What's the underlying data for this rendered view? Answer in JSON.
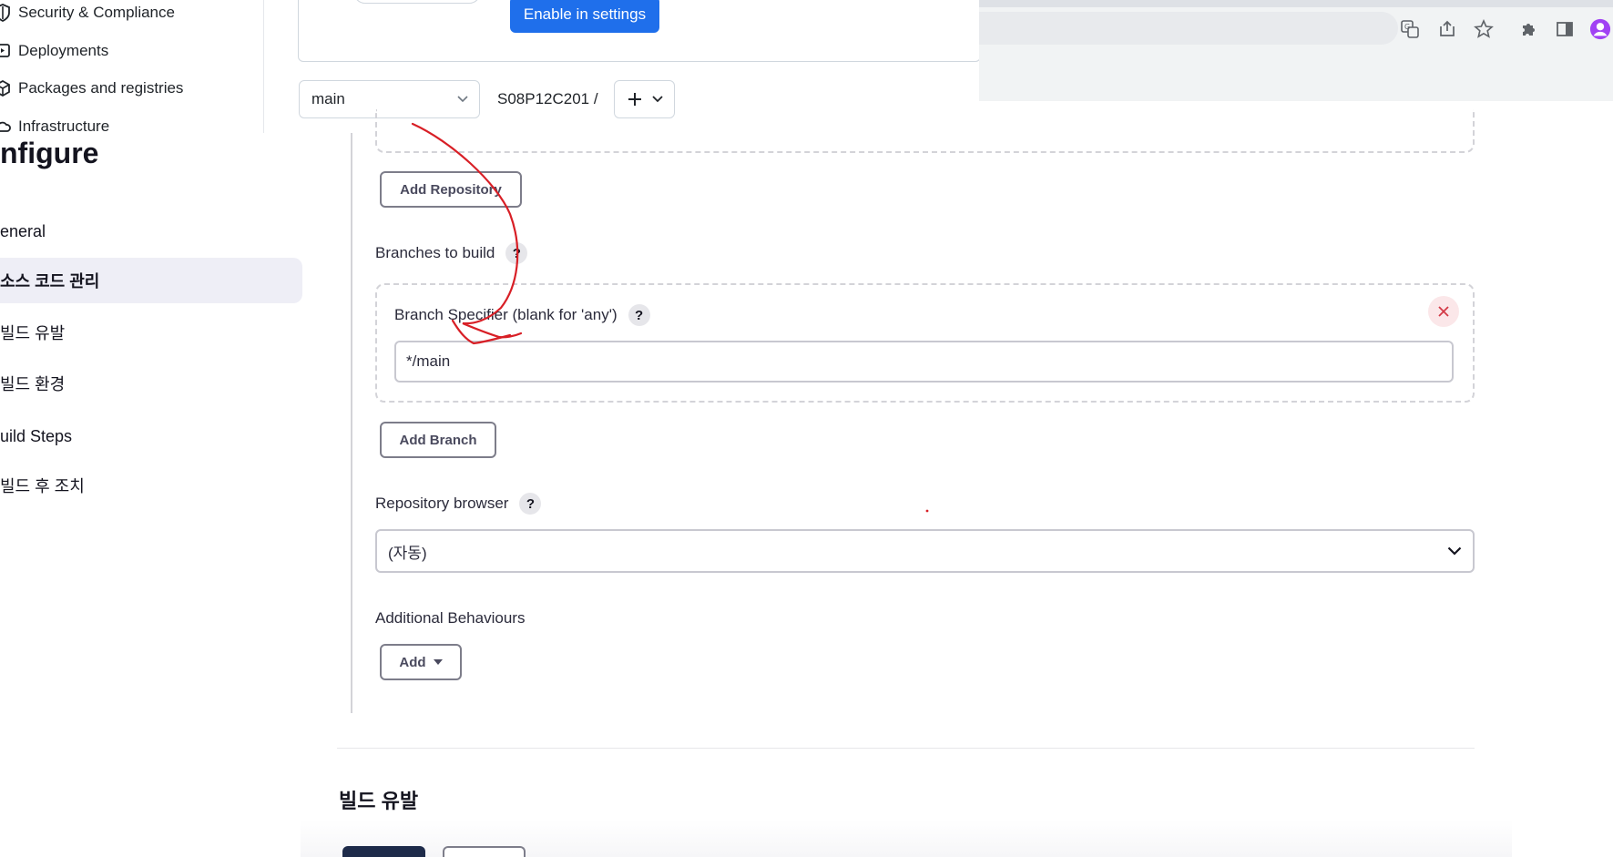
{
  "github": {
    "sidebar": [
      {
        "label": "Security & Compliance",
        "icon": "shield-icon"
      },
      {
        "label": "Deployments",
        "icon": "rocket-icon"
      },
      {
        "label": "Packages and registries",
        "icon": "package-icon"
      },
      {
        "label": "Infrastructure",
        "icon": "cloud-icon"
      }
    ],
    "enable_button": "Enable in settings",
    "branch_selector": "main",
    "repo_path": "S08P12C201  /",
    "add_button_icon": "plus-icon"
  },
  "chrome": {
    "icons": [
      "translate-icon",
      "share-icon",
      "star-icon",
      "extension-icon",
      "sidepanel-icon",
      "profile-avatar-icon"
    ]
  },
  "jenkins": {
    "title": "nfigure",
    "nav": [
      {
        "label": "eneral",
        "active": false
      },
      {
        "label": "소스 코드 관리",
        "active": true
      },
      {
        "label": "빌드 유발",
        "active": false
      },
      {
        "label": "빌드 환경",
        "active": false
      },
      {
        "label": "uild Steps",
        "active": false
      },
      {
        "label": "빌드 후 조치",
        "active": false
      }
    ],
    "add_repository": "Add Repository",
    "branches_to_build": "Branches to build",
    "help_glyph": "?",
    "branch_specifier_label": "Branch Specifier (blank for 'any')",
    "branch_specifier_value": "*/main",
    "add_branch": "Add Branch",
    "repository_browser_label": "Repository browser",
    "repository_browser_value": "(자동)",
    "additional_behaviours": "Additional Behaviours",
    "add_button": "Add",
    "next_section": "빌드 유발",
    "colors": {
      "accent_dark": "#1e2b4a",
      "active_nav_bg": "#eeeef6",
      "annotation": "#d81f26",
      "github_blue": "#1f6feb"
    }
  }
}
